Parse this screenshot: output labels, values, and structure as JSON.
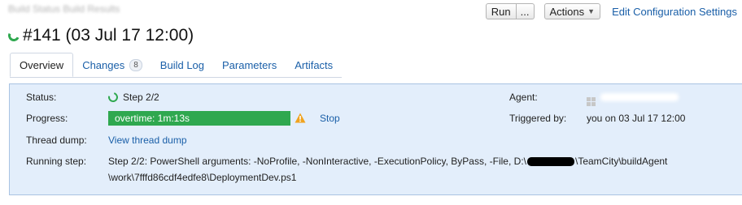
{
  "header": {
    "breadcrumb": "Build Status   Build Results",
    "run_label": "Run",
    "run_more_label": "...",
    "actions_label": "Actions",
    "edit_configuration_label": "Edit Configuration Settings"
  },
  "build": {
    "title": "#141 (03 Jul 17 12:00)",
    "status_color": "#2fa84f"
  },
  "tabs": [
    {
      "label": "Overview",
      "active": true
    },
    {
      "label": "Changes",
      "count": "8"
    },
    {
      "label": "Build Log"
    },
    {
      "label": "Parameters"
    },
    {
      "label": "Artifacts"
    }
  ],
  "details": {
    "status_label": "Status:",
    "status_value": "Step 2/2",
    "progress_label": "Progress:",
    "progress_value": "overtime: 1m:13s",
    "stop_label": "Stop",
    "thread_dump_label": "Thread dump:",
    "thread_dump_link": "View thread dump",
    "running_step_label": "Running step:",
    "running_step_line1_prefix": "Step 2/2: PowerShell arguments: -NoProfile, -NonInteractive, -ExecutionPolicy, ByPass, -File, D:\\",
    "running_step_line1_suffix": "\\TeamCity\\buildAgent",
    "running_step_line2": "\\work\\7fffd86cdf4edfe8\\DeploymentDev.ps1",
    "agent_label": "Agent:",
    "triggered_by_label": "Triggered by:",
    "triggered_by_value": "you on 03 Jul 17 12:00"
  }
}
